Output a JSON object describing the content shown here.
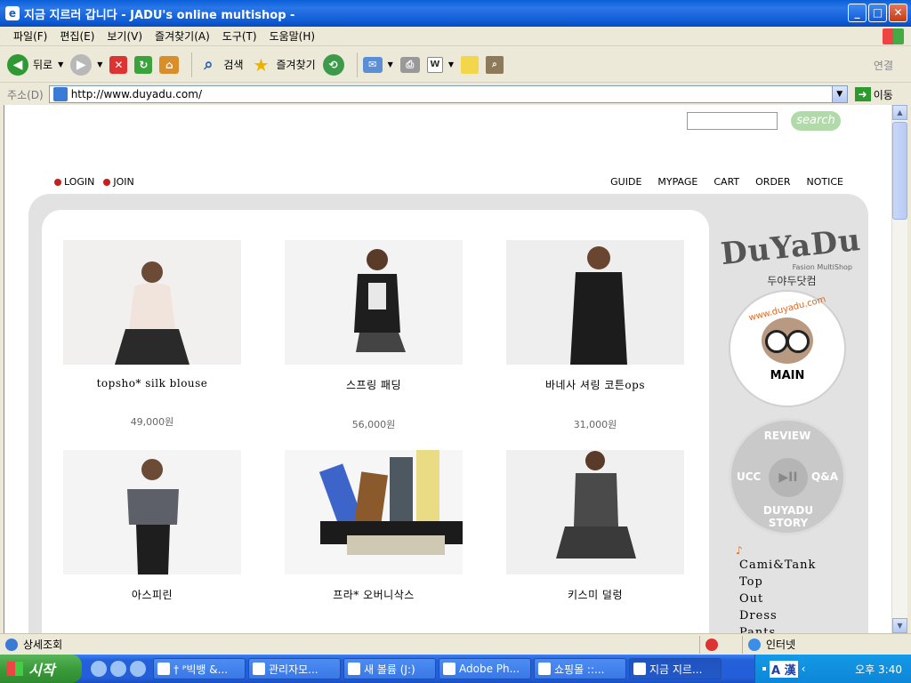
{
  "window": {
    "title": "지금 지르러 갑니다 - JADU's online multishop -"
  },
  "menu": [
    "파일(F)",
    "편집(E)",
    "보기(V)",
    "즐겨찾기(A)",
    "도구(T)",
    "도움말(H)"
  ],
  "toolbar": {
    "back": "뒤로",
    "search": "검색",
    "favorites": "즐겨찾기",
    "connect": "연결"
  },
  "address": {
    "label": "주소(D)",
    "url": "http://www.duyadu.com/",
    "go": "이동"
  },
  "site": {
    "search_button": "search",
    "login": "LOGIN",
    "join": "JOIN",
    "nav": [
      "GUIDE",
      "MYPAGE",
      "CART",
      "ORDER",
      "NOTICE"
    ],
    "logo": "DuYaDu",
    "logo_sub": "Fasion MultiShop",
    "logo_kor": "두야두닷컴",
    "main_url": "www.duyadu.com",
    "main_label": "MAIN",
    "wheel": {
      "top": "REVIEW",
      "left": "UCC",
      "right": "Q&A",
      "bottom": "DUYADU STORY",
      "center": "▶II"
    },
    "categories": [
      "Cami&Tank",
      "Top",
      "Out",
      "Dress",
      "Pants"
    ],
    "products": [
      {
        "name": "topsho* silk blouse",
        "price": "49,000원"
      },
      {
        "name": "스프링 패딩",
        "price": "56,000원"
      },
      {
        "name": "바네사 셔링 코튼ops",
        "price": "31,000원"
      },
      {
        "name": "아스피린",
        "price": ""
      },
      {
        "name": "프라* 오버니삭스",
        "price": ""
      },
      {
        "name": "키스미 덜렁",
        "price": ""
      }
    ]
  },
  "status": {
    "text": "상세조회",
    "zone": "인터넷"
  },
  "taskbar": {
    "start": "시작",
    "tasks": [
      "† ᴾ빅뱅 &...",
      "관리자모...",
      "새 볼륨 (J:)",
      "Adobe Ph...",
      "쇼핑몰 ::...",
      "지금 지르..."
    ],
    "lang": "A 漢",
    "clock": "오후 3:40"
  }
}
